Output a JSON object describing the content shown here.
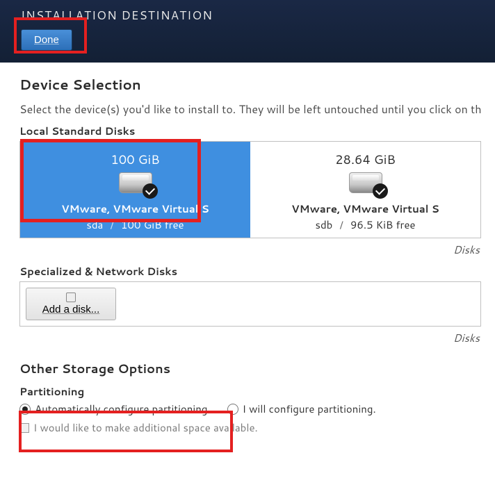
{
  "header": {
    "title": "INSTALLATION DESTINATION",
    "done_label": "Done"
  },
  "device_selection": {
    "title": "Device Selection",
    "description": "Select the device(s) you'd like to install to.  They will be left untouched until you click on the main menu's \"Begin Installation\" button.",
    "local_disks_label": "Local Standard Disks",
    "right_note": "Disks",
    "special_disks_label": "Specialized & Network Disks",
    "add_disk_label": "Add a disk...",
    "right_note2": "Disks"
  },
  "disks": [
    {
      "size": "100 GiB",
      "name": "VMware, VMware Virtual S",
      "dev": "sda",
      "free": "100 GiB free",
      "selected": true
    },
    {
      "size": "28.64 GiB",
      "name": "VMware, VMware Virtual S",
      "dev": "sdb",
      "free": "96.5 KiB free",
      "selected": false
    }
  ],
  "storage": {
    "title": "Other Storage Options",
    "partitioning_label": "Partitioning",
    "auto_label": "Automatically configure partitioning.",
    "manual_label": "I will configure partitioning.",
    "space_label": "I would like to make additional space available."
  }
}
